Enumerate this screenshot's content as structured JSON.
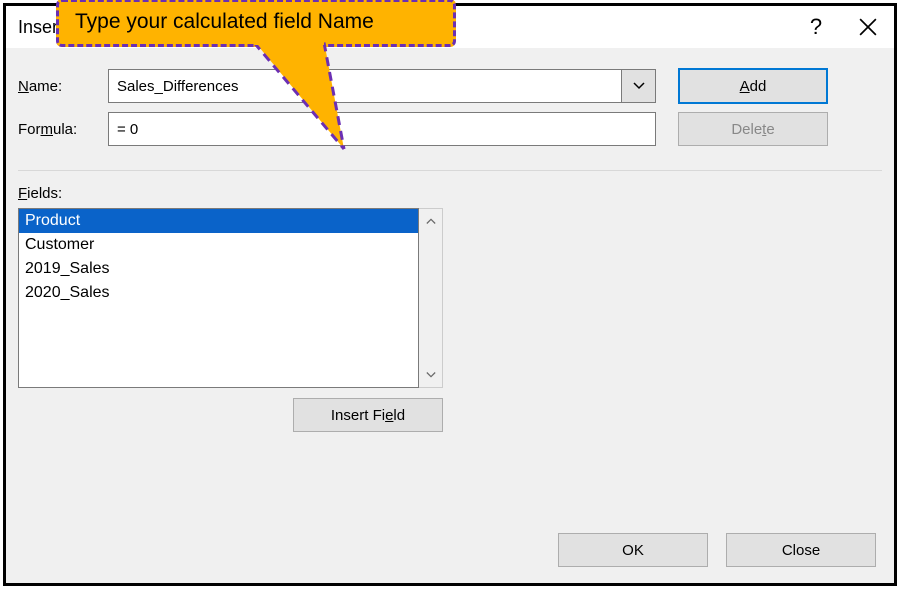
{
  "callout": {
    "text": "Type your calculated field Name"
  },
  "dialog": {
    "title": "Insert Calculated Field",
    "help_symbol": "?",
    "labels": {
      "name_prefix": "N",
      "name_rest": "ame:",
      "formula_prefix": "For",
      "formula_ul": "m",
      "formula_rest": "ula:",
      "fields_ul": "F",
      "fields_rest": "ields:"
    },
    "inputs": {
      "name_value": "Sales_Differences",
      "formula_value": "= 0"
    },
    "buttons": {
      "add_ul": "A",
      "add_rest": "dd",
      "delete_prefix": "Dele",
      "delete_ul": "t",
      "delete_rest": "e",
      "insert_prefix": "Insert Fi",
      "insert_ul": "e",
      "insert_rest": "ld",
      "ok": "OK",
      "close": "Close"
    },
    "fields": {
      "items": [
        {
          "label": "Product",
          "selected": true
        },
        {
          "label": "Customer",
          "selected": false
        },
        {
          "label": "2019_Sales",
          "selected": false
        },
        {
          "label": "2020_Sales",
          "selected": false
        }
      ]
    }
  }
}
